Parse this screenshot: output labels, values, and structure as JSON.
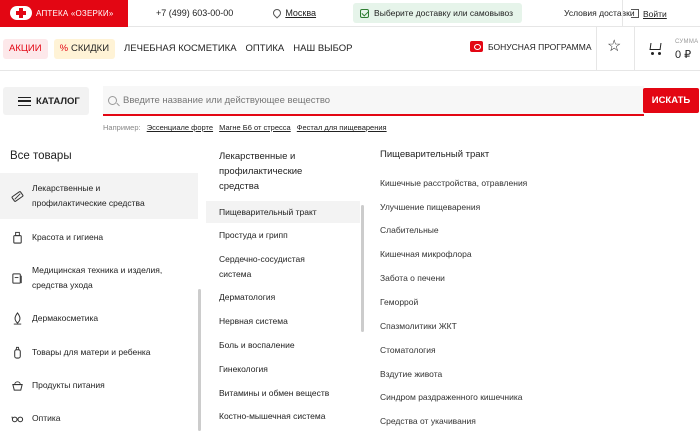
{
  "topbar": {
    "brand": "АПТЕКА «ОЗЕРКИ»",
    "phone": "+7 (499) 603-00-00",
    "city": "Москва",
    "delivery": "Выберите доставку или самовывоз",
    "conditions": "Условия доставки",
    "login": "Войти"
  },
  "nav": {
    "sale": "АКЦИИ",
    "discount_pct": "%",
    "discount": "СКИДКИ",
    "links": [
      "ЛЕЧЕБНАЯ КОСМЕТИКА",
      "ОПТИКА",
      "НАШ ВЫБОР"
    ],
    "bonus": "БОНУСНАЯ ПРОГРАММА",
    "sum_label": "СУММА",
    "sum_value": "0 ₽"
  },
  "search": {
    "catalog_label": "КАТАЛОГ",
    "placeholder": "Введите название или действующее вещество",
    "button": "ИСКАТЬ",
    "examples_label": "Например:",
    "examples": [
      "Эссенциале форте",
      "Магне Б6 от стресса",
      "Фестал для пищеварения"
    ]
  },
  "categories": {
    "title": "Все товары",
    "items": [
      {
        "line1": "Лекарственные и",
        "line2": "профилактические средства",
        "icon": "pills-icon"
      },
      {
        "line1": "Красота и гигиена",
        "line2": "",
        "icon": "cosmetics-icon"
      },
      {
        "line1": "Медицинская техника и изделия,",
        "line2": "средства ухода",
        "icon": "medical-equipment-icon"
      },
      {
        "line1": "Дермакосметика",
        "line2": "",
        "icon": "dermacosmetics-icon"
      },
      {
        "line1": "Товары для матери и ребенка",
        "line2": "",
        "icon": "baby-bottle-icon"
      },
      {
        "line1": "Продукты питания",
        "line2": "",
        "icon": "food-icon"
      },
      {
        "line1": "Оптика",
        "line2": "",
        "icon": "glasses-icon"
      }
    ]
  },
  "subcategories": {
    "title_line1": "Лекарственные и",
    "title_line2": "профилактические",
    "title_line3": "средства",
    "items": [
      {
        "line1": "Пищеварительный тракт",
        "line2": ""
      },
      {
        "line1": "Простуда и грипп",
        "line2": ""
      },
      {
        "line1": "Сердечно-сосудистая",
        "line2": "система"
      },
      {
        "line1": "Дерматология",
        "line2": ""
      },
      {
        "line1": "Нервная система",
        "line2": ""
      },
      {
        "line1": "Боль и воспаление",
        "line2": ""
      },
      {
        "line1": "Гинекология",
        "line2": ""
      },
      {
        "line1": "Витамины и обмен веществ",
        "line2": ""
      },
      {
        "line1": "Костно-мышечная система",
        "line2": ""
      }
    ]
  },
  "leaves": {
    "title": "Пищеварительный тракт",
    "items": [
      "Кишечные расстройства, отравления",
      "Улучшение пищеварения",
      "Слабительные",
      "Кишечная микрофлора",
      "Забота о печени",
      "Геморрой",
      "Спазмолитики ЖКТ",
      "Стоматология",
      "Вздутие живота",
      "Синдром раздраженного кишечника",
      "Средства от укачивания"
    ]
  },
  "colors": {
    "accent": "#e30613",
    "delivery_bg": "#e6f4ea",
    "sale_bg": "#fde8ea",
    "discount_bg": "#fff3d6"
  }
}
